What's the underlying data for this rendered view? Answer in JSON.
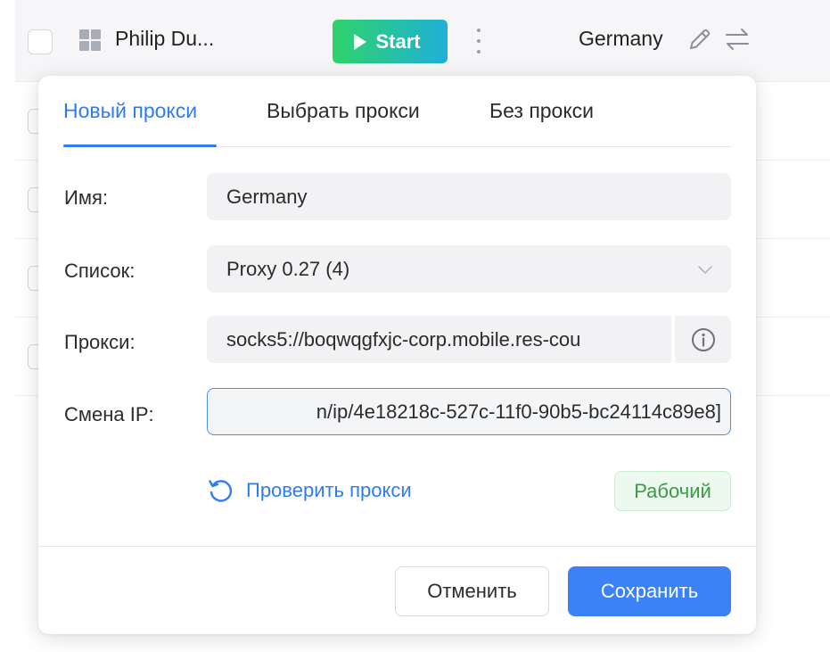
{
  "row": {
    "profile_name": "Philip Du...",
    "start_label": "Start",
    "proxy_name": "Germany"
  },
  "popup": {
    "tabs": [
      {
        "label": "Новый прокси",
        "active": true
      },
      {
        "label": "Выбрать прокси",
        "active": false
      },
      {
        "label": "Без прокси",
        "active": false
      }
    ],
    "fields": {
      "name_label": "Имя:",
      "name_value": "Germany",
      "list_label": "Список:",
      "list_value": "Proxy 0.27 (4)",
      "proxy_label": "Прокси:",
      "proxy_value": "socks5://boqwqgfxjc-corp.mobile.res-cou",
      "ip_change_label": "Смена IP:",
      "ip_change_value": "n/ip/4e18218c-527c-11f0-90b5-bc24114c89e8]"
    },
    "check_label": "Проверить прокси",
    "status": "Рабочий",
    "cancel_label": "Отменить",
    "save_label": "Сохранить"
  },
  "colors": {
    "accent": "#2f7cf0",
    "save_button": "#3a82f6",
    "status_text": "#3a9b45",
    "status_bg": "#edf9ee"
  },
  "icons": [
    "grid-icon",
    "play-icon",
    "kebab-menu-icon",
    "pencil-icon",
    "swap-arrows-icon",
    "chevron-down-icon",
    "info-icon",
    "refresh-icon"
  ]
}
